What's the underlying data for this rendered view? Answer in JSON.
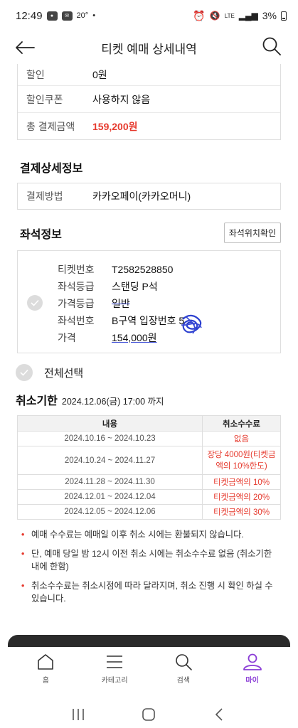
{
  "status_bar": {
    "time": "12:49",
    "temperature": "20°",
    "network": "LTE",
    "battery": "3%",
    "icons": [
      "talk-icon",
      "message-icon",
      "alarm-icon",
      "mute-icon",
      "signal-icon",
      "battery-icon"
    ]
  },
  "header": {
    "title": "티켓 예매 상세내역",
    "back_icon": "arrow-left-icon",
    "search_icon": "search-icon"
  },
  "payment_summary": [
    {
      "key": "할인",
      "value": "0원"
    },
    {
      "key": "할인쿠폰",
      "value": "사용하지 않음"
    },
    {
      "key": "총 결제금액",
      "value": "159,200원",
      "highlight": "#e63a2e"
    }
  ],
  "payment_detail": {
    "title": "결제상세정보",
    "method_key": "결제방법",
    "method_value": "카카오페이(카카오머니)"
  },
  "seat_info": {
    "title": "좌석정보",
    "location_button": "좌석위치확인",
    "rows": [
      {
        "key": "티켓번호",
        "value": "T2582528850"
      },
      {
        "key": "좌석등급",
        "value": "스탠딩 P석"
      },
      {
        "key": "가격등급",
        "value": "일반"
      },
      {
        "key": "좌석번호",
        "value": "B구역 입장번호 5"
      },
      {
        "key": "가격",
        "value": "154,000원"
      }
    ]
  },
  "select_all": "전체선택",
  "cancel_deadline": {
    "label": "취소기한",
    "value": "2024.12.06(금) 17:00 까지"
  },
  "fee_table": {
    "headers": [
      "내용",
      "취소수수료"
    ],
    "rows": [
      {
        "period": "2024.10.16 ~ 2024.10.23",
        "fee": "없음"
      },
      {
        "period": "2024.10.24 ~ 2024.11.27",
        "fee": "장당 4000원(티켓금액의 10%한도)"
      },
      {
        "period": "2024.11.28 ~ 2024.11.30",
        "fee": "티켓금액의 10%"
      },
      {
        "period": "2024.12.01 ~ 2024.12.04",
        "fee": "티켓금액의 20%"
      },
      {
        "period": "2024.12.05 ~ 2024.12.06",
        "fee": "티켓금액의 30%"
      }
    ]
  },
  "notes": [
    "예매 수수료는 예매일 이후 취소 시에는 환불되지 않습니다.",
    "단, 예매 당일 밤 12시 이전 취소 시에는 취소수수료 없음 (취소기한 내에 한함)",
    "취소수수료는 취소시점에 따라 달라지며, 취소 진행 시 확인 하실 수 있습니다."
  ],
  "tab_bar": [
    {
      "label": "홈",
      "icon": "home-icon",
      "active": false
    },
    {
      "label": "카테고리",
      "icon": "menu-icon",
      "active": false
    },
    {
      "label": "검색",
      "icon": "search-icon",
      "active": false
    },
    {
      "label": "마이",
      "icon": "person-icon",
      "active": true
    }
  ],
  "accent_color": "#8a3bd6",
  "price_color": "#e63a2e",
  "system_nav": [
    "recent-apps-icon",
    "home-nav-icon",
    "back-nav-icon"
  ]
}
